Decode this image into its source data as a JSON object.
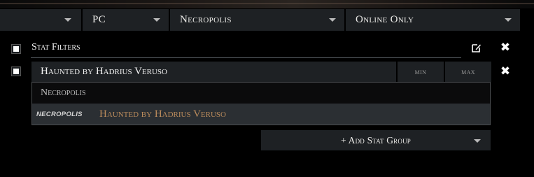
{
  "filters": {
    "platform": "PC",
    "league": "Necropolis",
    "status": "Online Only"
  },
  "stat_filters": {
    "title": "Stat Filters",
    "field_value": "Haunted by Hadrius Veruso",
    "min_placeholder": "min",
    "max_placeholder": "max"
  },
  "suggestions": {
    "group_header": "Necropolis",
    "item_tag": "NECROPOLIS",
    "item_name": "Haunted by Hadrius Veruso"
  },
  "add_group": {
    "label": "+ Add Stat Group"
  },
  "colors": {
    "panel": "#1e2124",
    "highlight": "#2b2f33",
    "item_gold": "#b98a5b"
  },
  "icons": [
    "chevron-down-icon",
    "edit-icon",
    "close-icon",
    "checkbox-icon"
  ]
}
